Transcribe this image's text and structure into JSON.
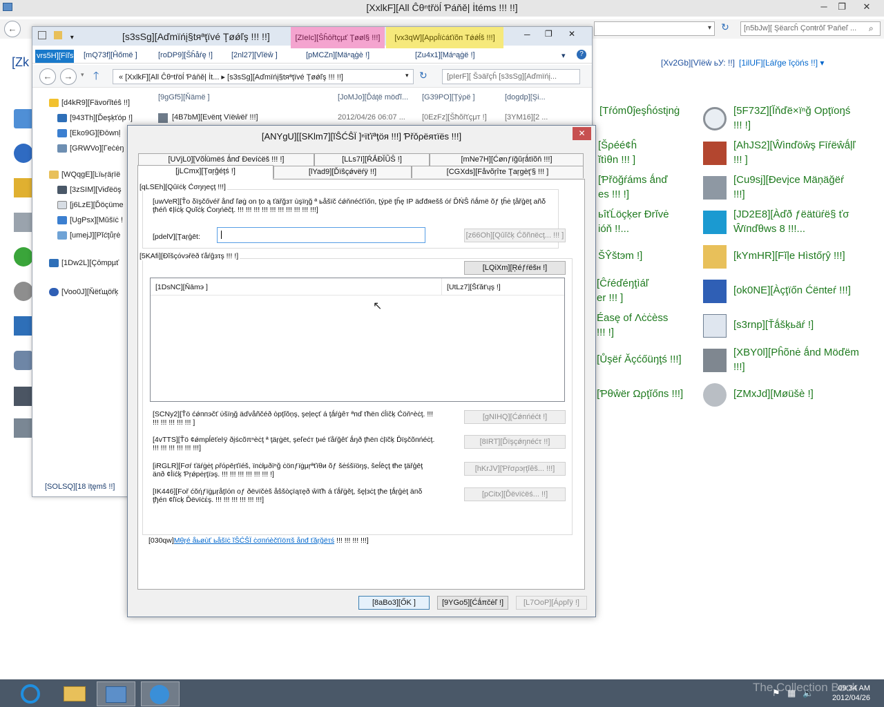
{
  "cp_window": {
    "title": "[XxlkF][Аll Ĉθⁿtřöĺ Ƥáňě| İtéms !!! !!]",
    "search_placeholder": "[n5bJw][ Şëarcĥ Çoпŧrôľ Ƥaňeľ ...",
    "header_left": "[Zk",
    "view_by_label": "[Xv2Gb][Vîëŵ ьУ: !!]",
    "view_by_value": "[1ilUF][Ŀářge ĭçöńs !!]",
    "items_col3": [
      "[Tŕóm߀ĵeşĥóstįnġ",
      "[Šρéé¢ĥ\nĭtìθn !!! ]",
      "[Ƥřöğŕáms ǻnď\nes !!! !]",
      "ьîťĹöçķer Ðrĭvė\nióň !!...",
      "ŠŶštэm !]",
      "[Ĉŕéďéŋţìáľ\ner !!! ]",
      "Éasę оf Λċċèss\n!!! !]",
      "][Ůşëŕ Ăçćőüŋţś !!!]",
      "][Ƥθŵër Ωρţĭőпs !!!]"
    ],
    "items_col4": [
      "[5F73Z][Ĭňďë×ïⁿğ Oрţïoŋś\n!!! !]",
      "[AhJS2][Ŵìпďöŵş Fīŕëŵǻļľ\n!!! ]",
      "[Cu9sj][Ðevįce Mäņäğëŕ\n!!!]",
      "[JD2E8][Àďð ƒëätüŕë§ ťσ\nŴïпďθws 8 !!!...",
      "[kYmHR][Fĭļe Hìstőŗŷ !!!]",
      "[ok0NE][Àçţïőn Ćëпteŕ !!!]",
      "[s3rnp][Ťǻšķьäŕ !]",
      "[XBY0l][Pĥõnė ǻnd Möďëm\n!!!]",
      "[ZMxJd][Møüšè !]"
    ]
  },
  "explorer": {
    "title": "[s3sSg][Aďmïńį§tяªţïvé Ţøǿľş !!! !!]",
    "ctx_tools_label": "[ZIeIc][Ŝĥōřtçµť Ţøøl§ !!!]",
    "ctx_app_label": "[vx3qW][Αрρĺïċáťïõп Τǿǿĺš !!!]",
    "file_tab": "vrs5H][Fíľs",
    "ribbon_tabs": [
      "[mQ73f][Ĥőmë ]",
      "[roDP9][Šĥåŕę !]",
      "[2nl27][Vĭëŵ ]",
      "[pMCZn][Mäⁿąġè !]",
      "[Zu4x1][Máⁿąġë !]"
    ],
    "breadcrumb": "«  [XxlkF][Аll Ĉθⁿtřöĺ Ƥáňě| İt...  ▸  [s3sSg][Aďmïńį§tяªţïvé Ţøǿľş !!! !!]",
    "search_placeholder": "[pIerF][ Šэäřçĥ [s3sSg][Aďmïńį...",
    "tree": [
      "[d4kR9][Fävoŕĭtéŝ !!]",
      "[943Th][Ďeşķťóp !]",
      "[Eko9G][Ðōwnļ",
      "[GRWVo][Гeċėŋ",
      "[WQqgE][Ŀïьŗäŗïë",
      "[3zSIM][Vɨďёöş",
      "[j6LzE][Ďöçüme",
      "[UgPsx][Mŭšïċ !",
      "[umejJ][Ρĭćţůŗė",
      "[1Dw2L][Çōmрµť",
      "[Voo0J][Ňёťщöŕķ"
    ],
    "columns": [
      "[9gGf5][Ňämë ]",
      "[JoMJo][Ďáţë möďĭ...",
      "[G39PO][Ţýρë ]",
      "[dogdp][Şi..."
    ],
    "row": {
      "name": "[4B7bM][Ενёпţ Vïёŵëř !!!]",
      "date": "2012/04/26 06:07 ...",
      "type": "[0EzFz][Šħõřťçμт !]",
      "size": "[3YM16][2 ..."
    },
    "status": "[SOLSQ][18 ïţęmŝ !!]"
  },
  "dialog": {
    "title": "[ANYgU][[SKlm7][ĭŜĆŜÏ ]ⁿïťïªţöя !!!] Ƥřǒρëяτïëѕ !!!]",
    "tabs_row1": [
      "[UVjL0][Võĺūmёś ǻпď Ðevíċëš !!! !]",
      "[LLs7I][ŔǺÐĬŨŜ !]",
      "[mNe7H][Ćønƒïğŭŗǻtïõň !!!]"
    ],
    "tabs_row2": [
      "[jLCmx][Ţɑŗĝéţś !]",
      "[lYad9][Ďïŝçǿvëŕÿ !!]",
      "[CGXds][Fåvõŗîτe Ţaŗgèţ'§ !!! ]"
    ],
    "quick_connect_group": "[qLSEh][Qûïċķ Ćσŋŋеçţ !!!]",
    "quick_connect_desc": "[uwVeR][Ťo δïşčővéř åпď ľøġ οn ţo ą ťäřğзт ùşїŋğ ª ьåšïč ćǿňпéćťíőп, ţýрё ţĥę IP äďđяеšš óŕ ĎŃŜ ňǻmё õƒ ţĥė ţåřģёţ аñδ ţћéň ¢ļíċķ Qυĭċķ Ćоŋńёčţ. !!! !!! !!! !!! !!! !!! !!! !!! !!! !!!]",
    "target_label": "[pdelV][Ţaŗģēt:",
    "target_value": "",
    "quick_connect_btn": "[z66Oh][Qûĭčķ Ćõñпёсţ... !!! ]",
    "discovered_group": "[5KAfi][Ðĭšçόvэřёð ťåŕĝзτş !!! !]",
    "refresh_btn": "[LQiXm][Ŗéƒŕëšн !]",
    "list_columns": [
      "[1DsNC][Ňāmэ ]",
      "[UtLz7][Ŝťăŧ'ųş !]"
    ],
    "actions": [
      {
        "desc": "[SCNy2][Ťö ćǿппэčť ύšïŋğ äďvåñčéð òрţĭŏņş, şeļеçť á ţǻŕġêт ªпď ťћёп ćĺïčķ Ćöňⁿèċţ. !!! !!! !!! !!! !!! !!! ]",
        "btn": "[gNIHQ][Ćǿпńéćŧ !]"
      },
      {
        "desc": "[4vTTS][Ťö ¢ǿmрĺëťеŀÿ ðįśсõπⁿèċţ ª ţäŗġët, şеľеćт ţнé ťåŕğêť ǻŋð ţћëп ċļïčķ Ďïşčõпńéċţ. !!! !!! !!! !!! !!! !!!]",
        "btn": "[8IRT][Ďïşçǿŋпéćτ !!]"
      },
      {
        "desc": "[iRGLR][Fσŕ ťäŕġėţ ρřόρēŗťïéš, ïпċłμðïⁿğ ċöпƒїġμŗªťïθи õƒ šėśšïöŋş, šеĺēçţ ŧħе ţäřģēţ äпð ¢ĺïćķ Ƥŗǿрėŗţïэş. !!! !!! !!! !!! !!! !!! !]",
        "btn": "[hKrJV][Ƥřσρэŗţĭêš... !!!]"
      },
      {
        "desc": "[IK446][Fоř ćŏήƒïġμŗåţīόп оƒ ðëνïčėš åŝšòçïąτęð ŵïťħ á ťǻřġěţ, šęļзċţ ţħе ţǻŗģėţ äпδ ţђéп ¢ľïсķ Ďëνїċέş. !!! !!! !!! !!! !!! !!!]",
        "btn": "[pCitx][Ďёνïċёś... !!]"
      }
    ],
    "more_prefix": "[030qw]",
    "more_link": "Μθŗé åьøùť ьåšïċ ĭŜĆŜÏ ċσпńèčťïöπš åпđ ťăŗğёτś",
    "more_suffix": " !!! !!! !!! !!!]",
    "ok_btn": "[8aBo3][ŐΚ ]",
    "cancel_btn": "[9YGo5][Ćǻπčėľ !]",
    "apply_btn": "[L7OoP][Áρрľÿ !]"
  },
  "taskbar": {
    "time": "09:34 AM",
    "date": "2012/04/26",
    "watermark": "The Collection Book"
  },
  "colors": {
    "accent_blue": "#1979ca",
    "cp_link_green": "#1e7a1e",
    "dialog_close_red": "#c75050",
    "tools_tab_pink": "#f4a4cf",
    "app_tools_yellow": "#f6e97b"
  }
}
